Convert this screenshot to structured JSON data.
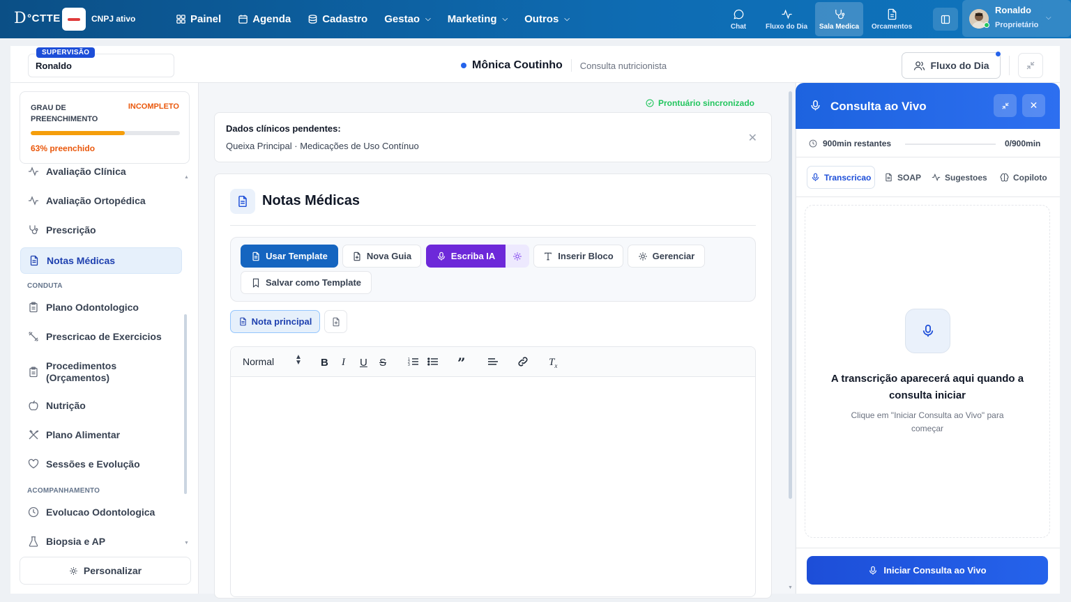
{
  "topnav": {
    "logo": "DOCTTE",
    "company": "CNPJ ativo",
    "menu": [
      {
        "label": "Painel",
        "icon": "grid-icon"
      },
      {
        "label": "Agenda",
        "icon": "calendar-icon"
      },
      {
        "label": "Cadastro",
        "icon": "database-icon"
      },
      {
        "label": "Gestao",
        "icon": ""
      },
      {
        "label": "Marketing",
        "icon": ""
      },
      {
        "label": "Outros",
        "icon": ""
      }
    ],
    "quick": [
      {
        "label": "Chat",
        "icon": "chat-icon"
      },
      {
        "label": "Fluxo do Dia",
        "icon": "activity-icon"
      },
      {
        "label": "Sala Medica",
        "icon": "stethoscope-icon",
        "active": true
      },
      {
        "label": "Orcamentos",
        "icon": "file-icon"
      }
    ],
    "user": {
      "name": "Ronaldo",
      "role": "Proprietário"
    }
  },
  "subbar": {
    "badge": "SUPERVISÃO",
    "supervisor": "Ronaldo",
    "patient_name": "Mônica Coutinho",
    "consult_type": "Consulta nutricionista",
    "fluxo_label": "Fluxo do Dia"
  },
  "sidebar": {
    "grau": {
      "label": "GRAU DE PREENCHIMENTO",
      "status": "INCOMPLETO",
      "progress": 0.63,
      "pct_text": "63% preenchido"
    },
    "items": [
      {
        "label": "Avaliação Clínica",
        "icon": "activity-icon"
      },
      {
        "label": "Avaliação Ortopédica",
        "icon": "activity-icon"
      },
      {
        "label": "Prescrição",
        "icon": "stethoscope-icon"
      },
      {
        "label": "Notas Médicas",
        "icon": "file-text-icon",
        "active": true
      },
      {
        "label": "Plano Odontologico",
        "icon": "clipboard-icon"
      },
      {
        "label": "Prescricao de Exercicios",
        "icon": "dumbbell-icon"
      },
      {
        "label": "Procedimentos (Orçamentos)",
        "icon": "clipboard-icon"
      },
      {
        "label": "Nutrição",
        "icon": "apple-icon"
      },
      {
        "label": "Plano Alimentar",
        "icon": "utensils-icon"
      },
      {
        "label": "Sessões e Evolução",
        "icon": "heart-icon"
      },
      {
        "label": "Evolucao Odontologica",
        "icon": "clock-icon"
      },
      {
        "label": "Biopsia e AP",
        "icon": "flask-icon"
      }
    ],
    "sections": {
      "conduta": "CONDUTA",
      "acompanhamento": "ACOMPANHAMENTO"
    },
    "personalizar": "Personalizar"
  },
  "main": {
    "sync": "Prontuário sincronizado",
    "pending_title": "Dados clínicos pendentes:",
    "pending_detail": "Queixa Principal · Medicações de Uso Contínuo",
    "notes_title": "Notas Médicas",
    "toolbar": {
      "usar_template": "Usar Template",
      "nova_guia": "Nova Guia",
      "escriba": "Escriba IA",
      "inserir_bloco": "Inserir Bloco",
      "gerenciar": "Gerenciar",
      "salvar_template": "Salvar como Template"
    },
    "nota_tab": "Nota principal",
    "editor": {
      "style_select": "Normal"
    }
  },
  "live": {
    "title": "Consulta ao Vivo",
    "remaining": "900min restantes",
    "count": "0/900min",
    "tabs": [
      {
        "label": "Transcricao",
        "icon": "mic-icon",
        "active": true
      },
      {
        "label": "SOAP",
        "icon": "file-icon"
      },
      {
        "label": "Sugestoes",
        "icon": "activity-icon"
      },
      {
        "label": "Copiloto",
        "icon": "brain-icon"
      }
    ],
    "empty_title": "A transcrição aparecerá aqui quando a consulta iniciar",
    "empty_sub": "Clique em \"Iniciar Consulta ao Vivo\" para começar",
    "start_button": "Iniciar Consulta ao Vivo"
  },
  "colors": {
    "primary": "#1565c0",
    "accent_purple": "#6d28d9",
    "warning": "#ea580c",
    "success": "#22c55e"
  }
}
